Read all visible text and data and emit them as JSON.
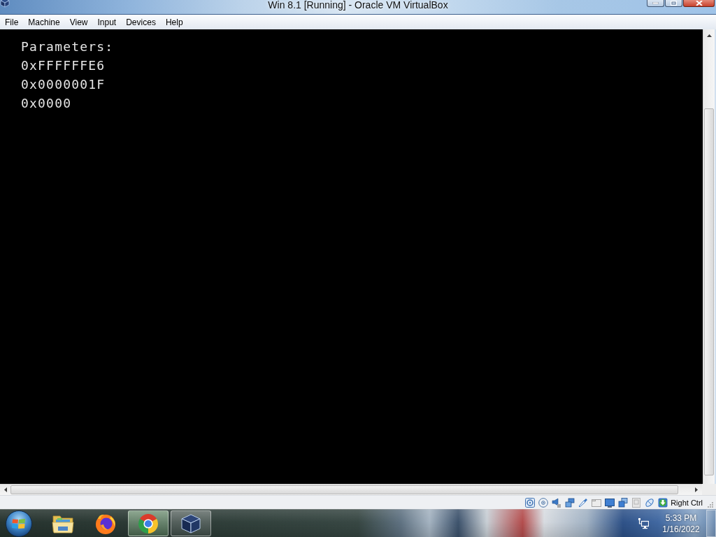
{
  "window": {
    "title": "Win 8.1 [Running] - Oracle VM VirtualBox"
  },
  "menu_bar": {
    "items": [
      "File",
      "Machine",
      "View",
      "Input",
      "Devices",
      "Help"
    ]
  },
  "vm_screen": {
    "lines": [
      "Parameters:",
      "0xFFFFFFE6",
      "0x0000001F",
      "0x0000"
    ]
  },
  "status_bar": {
    "host_key": "Right Ctrl"
  },
  "taskbar": {
    "apps": [
      {
        "kind": "folder",
        "running": false,
        "hovered": false
      },
      {
        "kind": "fox",
        "running": false,
        "hovered": false
      },
      {
        "kind": "ring",
        "running": true,
        "hovered": true
      },
      {
        "kind": "cube",
        "running": true,
        "hovered": false
      }
    ],
    "clock": {
      "time": "5:33 PM",
      "date": "1/16/2022"
    }
  }
}
